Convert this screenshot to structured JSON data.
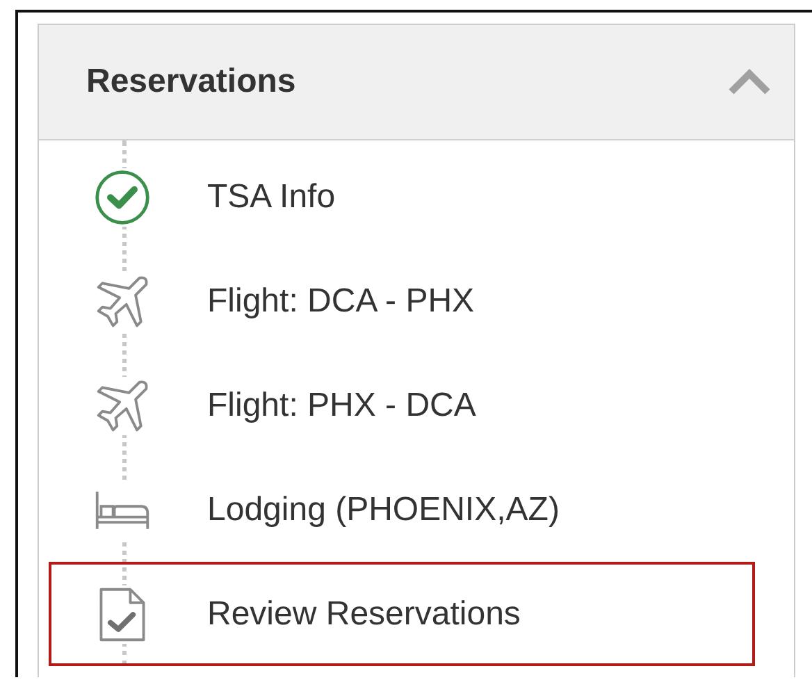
{
  "panel": {
    "title": "Reservations",
    "expanded": true,
    "items": [
      {
        "kind": "done",
        "label": "TSA Info",
        "selected": false
      },
      {
        "kind": "flight",
        "label": "Flight: DCA - PHX",
        "selected": false
      },
      {
        "kind": "flight",
        "label": "Flight: PHX - DCA",
        "selected": false
      },
      {
        "kind": "lodging",
        "label": "Lodging (PHOENIX,AZ)",
        "selected": false
      },
      {
        "kind": "review",
        "label": "Review Reservations",
        "selected": true
      }
    ]
  }
}
